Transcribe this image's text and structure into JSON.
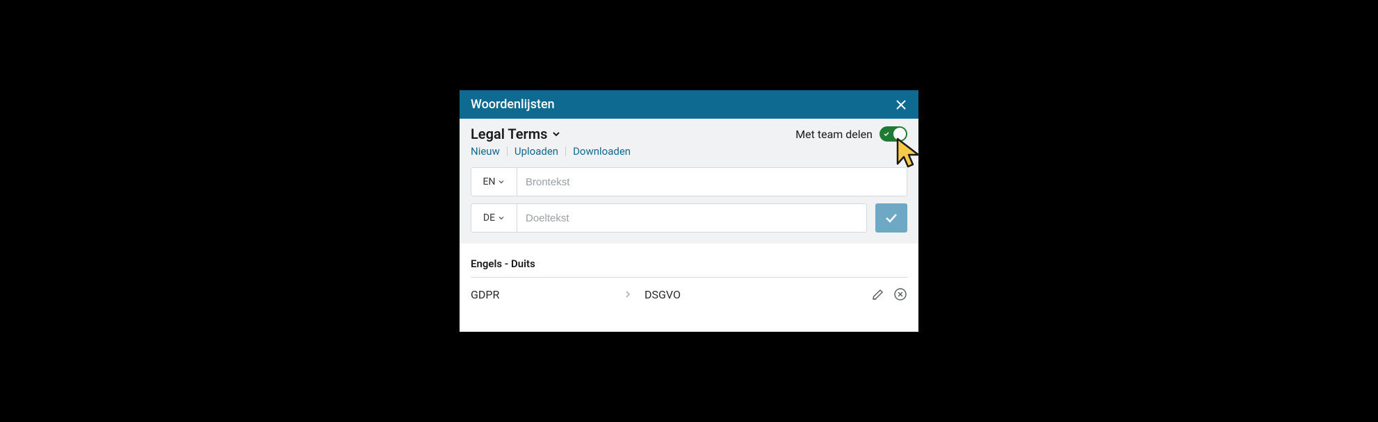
{
  "modal": {
    "title": "Woordenlijsten"
  },
  "glossary": {
    "name": "Legal Terms",
    "share_label": "Met team delen"
  },
  "actions": {
    "new": "Nieuw",
    "upload": "Uploaden",
    "download": "Downloaden"
  },
  "inputs": {
    "source_lang": "EN",
    "target_lang": "DE",
    "source_placeholder": "Brontekst",
    "target_placeholder": "Doeltekst"
  },
  "pair_header": "Engels - Duits",
  "entries": [
    {
      "source": "GDPR",
      "target": "DSGVO"
    }
  ]
}
